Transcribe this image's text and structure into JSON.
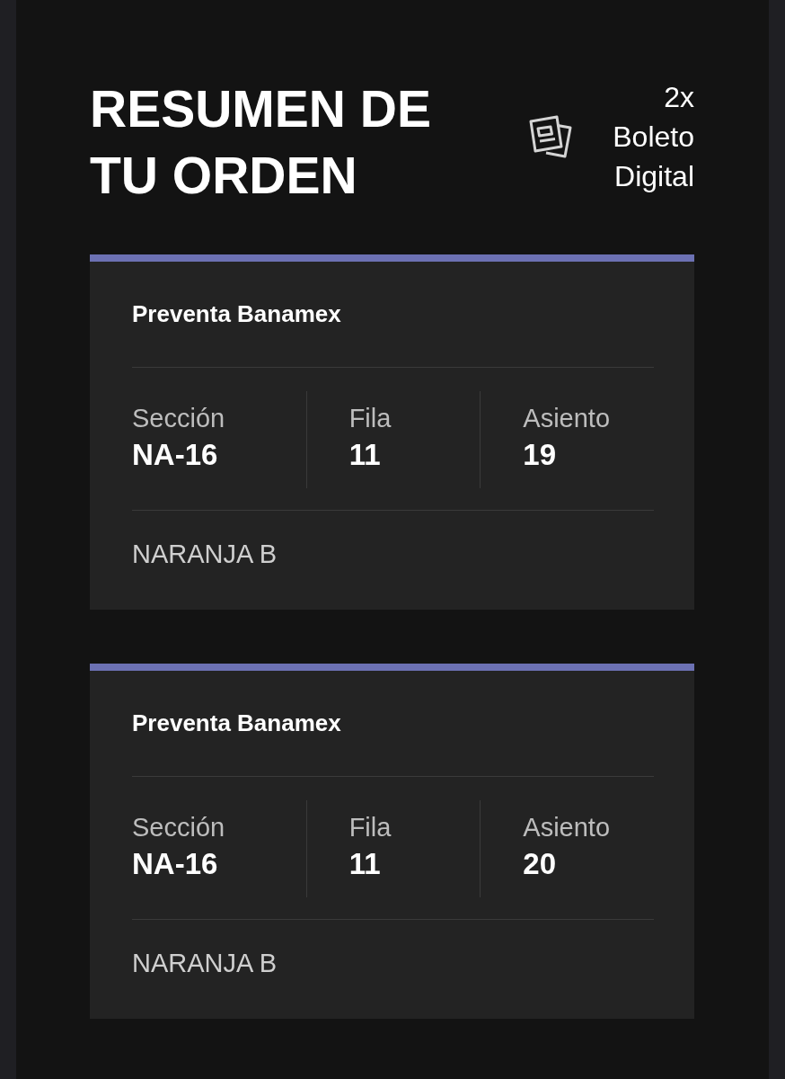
{
  "header": {
    "title": "RESUMEN DE TU ORDEN",
    "quantity": "2x Boleto Digital"
  },
  "tickets": [
    {
      "title": "Preventa Banamex",
      "fields": [
        {
          "label": "Sección",
          "value": "NA-16"
        },
        {
          "label": "Fila",
          "value": "11"
        },
        {
          "label": "Asiento",
          "value": "19"
        }
      ],
      "zone": "NARANJA B"
    },
    {
      "title": "Preventa Banamex",
      "fields": [
        {
          "label": "Sección",
          "value": "NA-16"
        },
        {
          "label": "Fila",
          "value": "11"
        },
        {
          "label": "Asiento",
          "value": "20"
        }
      ],
      "zone": "NARANJA B"
    }
  ]
}
